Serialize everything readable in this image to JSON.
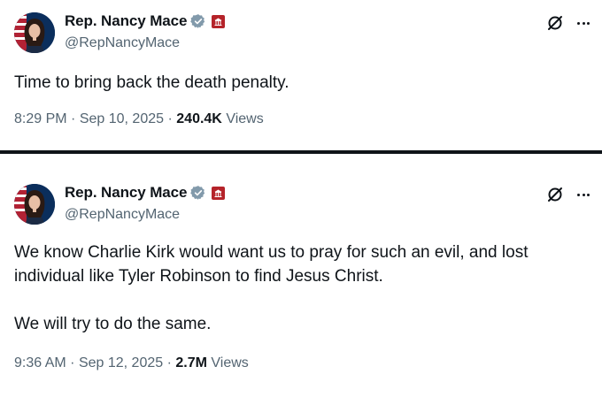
{
  "tweets": [
    {
      "display_name": "Rep. Nancy Mace",
      "handle": "@RepNancyMace",
      "text": "Time to bring back the death penalty.",
      "time": "8:29 PM",
      "date": "Sep 10, 2025",
      "views_count": "240.4K",
      "views_label": "Views",
      "separator": "·"
    },
    {
      "display_name": "Rep. Nancy Mace",
      "handle": "@RepNancyMace",
      "text": "We know Charlie Kirk would want us to pray for such an evil, and lost\nindividual like Tyler Robinson to find Jesus Christ.\n\nWe will try to do the same.",
      "time": "9:36 AM",
      "date": "Sep 12, 2025",
      "views_count": "2.7M",
      "views_label": "Views",
      "separator": "·"
    }
  ],
  "icons": {
    "verified": "verified-badge-icon",
    "government": "government-badge-icon",
    "grok": "grok-icon",
    "more": "more-icon"
  },
  "colors": {
    "verified_badge": "#829aab",
    "government_badge": "#b5232a",
    "secondary_text": "#536471",
    "primary_text": "#0f1419"
  }
}
